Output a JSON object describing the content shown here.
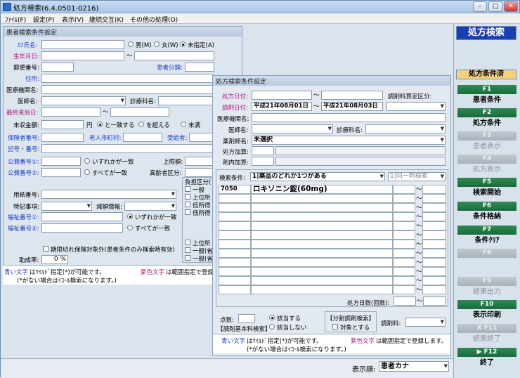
{
  "title": "処方検索(6.4.0501-0216)",
  "menu": [
    "ﾌｧｲﾙ(F)",
    "設定(P)",
    "表示(V)",
    "継続交互(K)",
    "その他の処理(O)"
  ],
  "patient": {
    "title": "患者検索条件設定",
    "kana": "ｶﾅ氏名:",
    "male": "男(M)",
    "female": "女(W)",
    "unspec": "未指定(A)",
    "birth": "生年月日:",
    "tilde": "～",
    "zip": "郵便番号:",
    "ptype": "患者分類:",
    "address": "住所:",
    "inst": "医療機関名:",
    "doctor": "医師名:",
    "dept": "診療科名:",
    "lastvisit": "最終来局日:",
    "unpaid": "未収金額:",
    "yen": "円",
    "eq": "と一致する",
    "over": "を超える",
    "under": "未満",
    "insurer": "保険者番号:",
    "elder": "老人市町村:",
    "recipient": "受給者:",
    "symbol": "記号・番号:",
    "pub1": "公費番号①:",
    "pub2": "公費番号②:",
    "anyone": "いずれかが一致",
    "all": "すべてが一致",
    "limit": "上限額:",
    "elderlv": "高齢者区分:",
    "paper": "用紙番号:",
    "special": "特記事項:",
    "reduction": "減額情報:",
    "welfare1": "福祉番号①:",
    "welfare2": "福祉番号②:",
    "burden": "負担区分(",
    "b1": "一般",
    "b2": "上位所",
    "b3": "低所得",
    "b4": "低所得",
    "b5": "上位所",
    "b6": "一般(省",
    "b7": "一般(省",
    "expired": "期限切れ保険対象外(患者条件のみ検索時有効)",
    "assist": "助成率:",
    "zero": "0",
    "pct": "%",
    "note1a": "青い文字",
    "note1b": "はﾜｲﾙﾄﾞ指定(*)が可能です。",
    "note1c": "紫色文字",
    "note1d": "は範囲指定で登録し",
    "note2": "(*がない場合はｲｺｰﾙ検索になります。)"
  },
  "rx": {
    "title": "処方検索条件設定",
    "rxdate": "処方日付:",
    "dispdate": "調剤日付:",
    "from": "平成21年08月01日",
    "to": "平成21年08月03日",
    "feeclass": "調剤料算定区分:",
    "inst": "医療機関名:",
    "doctor": "医師名:",
    "dept": "診療科名:",
    "drugdept": "薬剤師名:",
    "drugval": "未選択",
    "add1": "処方加算:",
    "add2": "剤内加算:",
    "cond": "検索条件:",
    "condval": "1|薬品のどれか1つがある",
    "same": "1|同一剤検索",
    "code": "7050",
    "drug": "ロキソニン錠(60mg)",
    "days": "処方日数(回数):",
    "points": "点数:",
    "yes": "該当する",
    "no": "該当しない",
    "split": "【分割調剤検索】",
    "target": "対象とする",
    "basic": "【調剤基本料検索】",
    "fee": "調剤料:",
    "note1a": "青い文字",
    "note1b": "はﾜｲﾙﾄﾞ指定(*)が可能です。",
    "note1c": "紫色文字",
    "note1d": "は範囲指定で登録します。",
    "note2": "(*がない場合はｲｺｰﾙ検索になります。)"
  },
  "side": {
    "header": "処方検索",
    "state": "処方条件済",
    "keys": [
      [
        "F1",
        "患者条件",
        true
      ],
      [
        "F2",
        "処方条件",
        true
      ],
      [
        "F3",
        "患者表示",
        false
      ],
      [
        "F4",
        "処方表示",
        false
      ],
      [
        "F5",
        "検索開始",
        true
      ],
      [
        "F6",
        "条件格納",
        true
      ],
      [
        "F7",
        "条件ｸﾘｱ",
        true
      ],
      [
        "F8",
        "",
        false
      ],
      [
        "F9",
        "結果出力",
        false
      ],
      [
        "F10",
        "表示印刷",
        true
      ],
      [
        "X F11",
        "結果終了",
        false
      ],
      [
        "▶ F12",
        "終了",
        true
      ]
    ]
  },
  "status": {
    "order": "表示順:",
    "orderval": "患者カナ"
  },
  "colors": {
    "blue": "#1a3ec8",
    "purple": "#b01880",
    "green": "#1a6a3c"
  }
}
